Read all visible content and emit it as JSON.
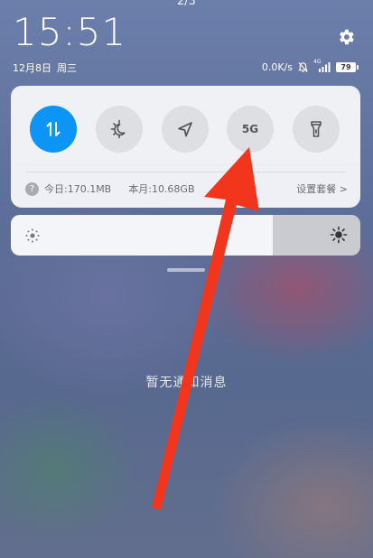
{
  "page_indicator": "2/3",
  "status": {
    "time": "15:51",
    "date": "12月8日",
    "weekday": "周三",
    "net_speed": "0.0K/s",
    "network_type": "4G",
    "battery_level": "79"
  },
  "quick_settings": {
    "tiles": [
      {
        "name": "data-transfer",
        "icon": "up-down-arrows-icon",
        "active": true
      },
      {
        "name": "dark-mode",
        "icon": "sun-moon-icon",
        "active": false
      },
      {
        "name": "location",
        "icon": "navigation-arrow-icon",
        "active": false
      },
      {
        "name": "5g",
        "label": "5G",
        "active": false
      },
      {
        "name": "flashlight",
        "icon": "flashlight-icon",
        "active": false
      }
    ],
    "usage": {
      "help_icon_text": "?",
      "today": "今日:170.1MB",
      "month": "本月:10.68GB",
      "plan_link": "设置套餐 >"
    }
  },
  "brightness": {
    "level": 0.75
  },
  "notifications": {
    "empty_text": "暂无通知消息"
  },
  "colors": {
    "accent": "#0d95f5",
    "annotation_arrow": "#f2361d"
  }
}
